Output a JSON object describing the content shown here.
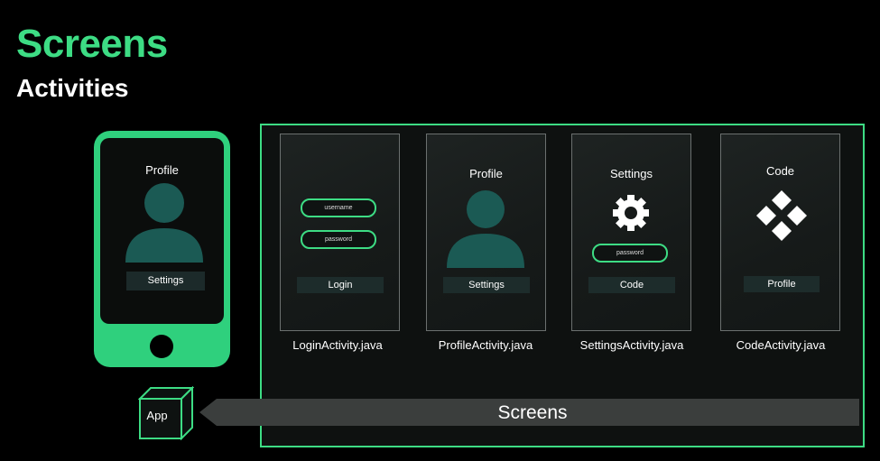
{
  "heading": {
    "title": "Screens",
    "subtitle": "Activities"
  },
  "phone": {
    "screen_title": "Profile",
    "button_label": "Settings"
  },
  "cards": [
    {
      "title": "",
      "fields": [
        "username",
        "password"
      ],
      "button": "Login",
      "caption": "LoginActivity.java",
      "icon": "none"
    },
    {
      "title": "Profile",
      "fields": [],
      "button": "Settings",
      "caption": "ProfileActivity.java",
      "icon": "person-icon"
    },
    {
      "title": "Settings",
      "fields": [
        "password"
      ],
      "button": "Code",
      "caption": "SettingsActivity.java",
      "icon": "gear-icon"
    },
    {
      "title": "Code",
      "fields": [],
      "button": "Profile",
      "caption": "CodeActivity.java",
      "icon": "diamond-logo-icon"
    }
  ],
  "bar": {
    "label": "Screens"
  },
  "app": {
    "label": "App"
  },
  "colors": {
    "accent": "#3ddc84",
    "avatar": "#1b5a54",
    "bar": "#3b3e3d"
  }
}
